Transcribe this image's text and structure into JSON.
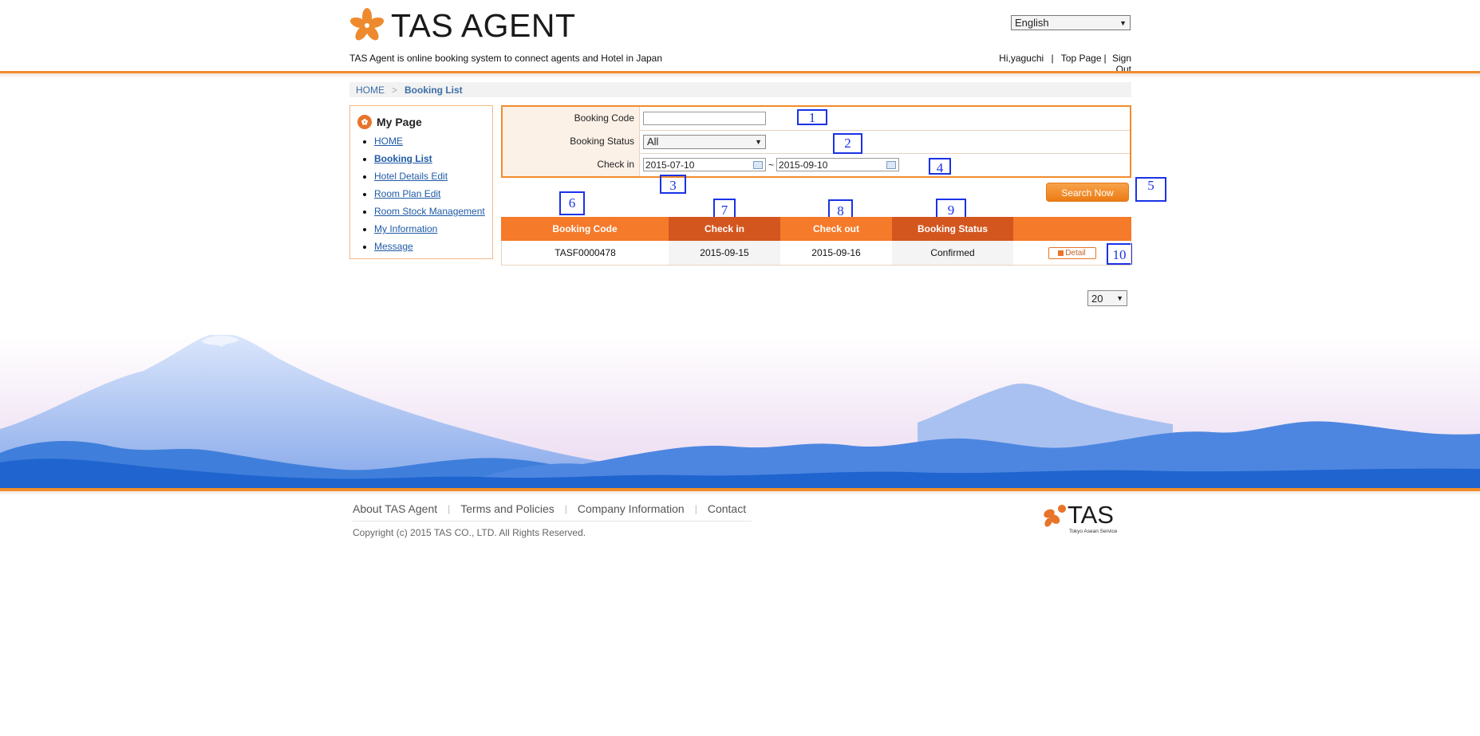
{
  "header": {
    "logo_text": "TAS AGENT",
    "tagline": "TAS Agent is online booking system to connect agents and Hotel in Japan",
    "language": "English",
    "greeting": "Hi,yaguchi",
    "top_page": "Top Page",
    "sign_out": "Sign Out"
  },
  "breadcrumb": {
    "home": "HOME",
    "separator": ">",
    "current": "Booking List"
  },
  "sidebar": {
    "title": "My Page",
    "items": [
      {
        "label": "HOME"
      },
      {
        "label": "Booking List"
      },
      {
        "label": "Hotel Details Edit"
      },
      {
        "label": "Room Plan Edit"
      },
      {
        "label": "Room Stock Management"
      },
      {
        "label": "My Information"
      },
      {
        "label": "Message"
      }
    ]
  },
  "search": {
    "booking_code_label": "Booking Code",
    "booking_code_value": "",
    "booking_status_label": "Booking Status",
    "booking_status_value": "All",
    "check_in_label": "Check in",
    "check_in_from": "2015-07-10",
    "range_sep": "~",
    "check_in_to": "2015-09-10",
    "button": "Search Now"
  },
  "annotations": [
    "1",
    "2",
    "3",
    "4",
    "5",
    "6",
    "7",
    "8",
    "9",
    "10"
  ],
  "table": {
    "headers": [
      "Booking Code",
      "Check in",
      "Check out",
      "Booking Status",
      ""
    ],
    "rows": [
      {
        "booking_code": "TASF0000478",
        "check_in": "2015-09-15",
        "check_out": "2015-09-16",
        "status": "Confirmed",
        "action": "Detail"
      }
    ]
  },
  "pagination": {
    "per_page": "20"
  },
  "footer": {
    "links": [
      "About TAS Agent",
      "Terms and Policies",
      "Company Information",
      "Contact"
    ],
    "copyright": "Copyright (c) 2015 TAS CO., LTD. All Rights Reserved.",
    "logo_text": "TAS",
    "logo_sub": "Tokyo Asean Service"
  },
  "colors": {
    "brand_orange": "#f08c2c",
    "header_orange": "#f57a2a",
    "header_dark_orange": "#d4561f",
    "link_blue": "#1f5aa6",
    "annotation_blue": "#1a33e6"
  }
}
